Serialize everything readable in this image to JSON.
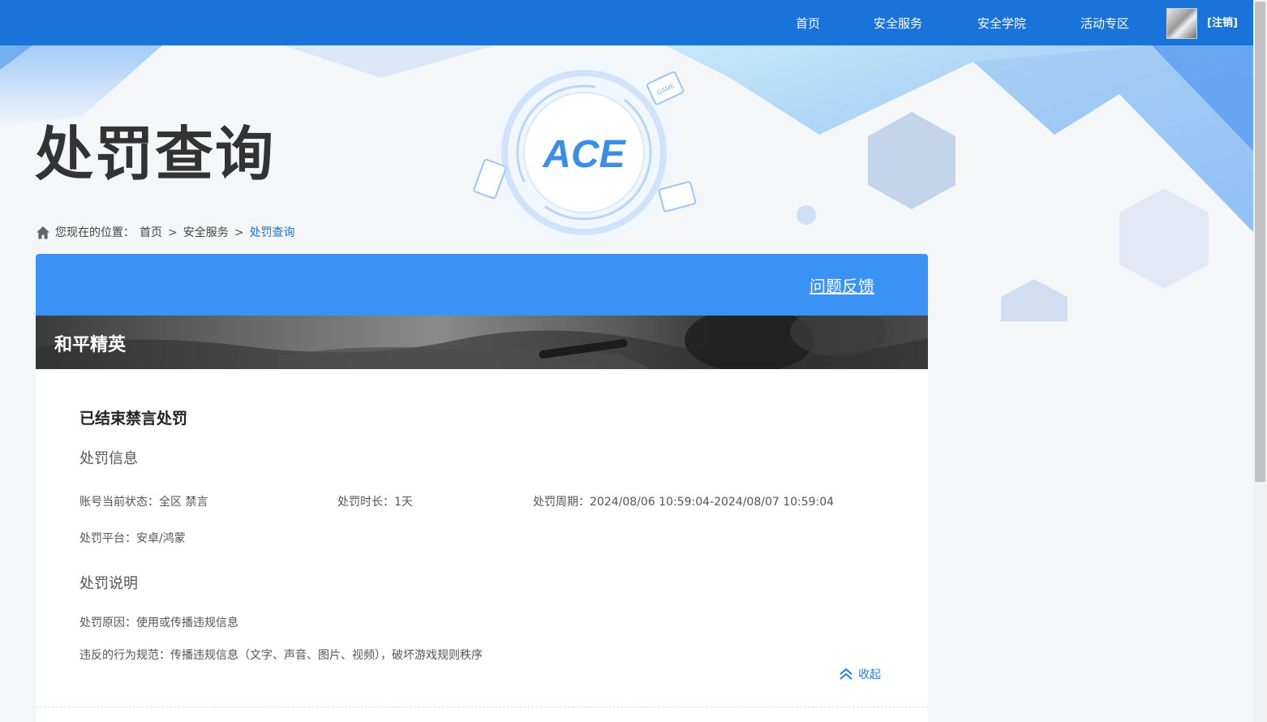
{
  "nav": {
    "items": [
      "首页",
      "安全服务",
      "安全学院",
      "活动专区"
    ],
    "logout": "[注销]"
  },
  "hero": {
    "title": "处罚查询",
    "logo_text": "ACE",
    "badge_text": "GAME"
  },
  "breadcrumb": {
    "prefix": "您现在的位置：",
    "items": [
      "首页",
      "安全服务",
      "处罚查询"
    ],
    "separator": ">"
  },
  "panel": {
    "feedback_link": "问题反馈",
    "game_name": "和平精英"
  },
  "penalty": {
    "status_title": "已结束禁言处罚",
    "info_title": "处罚信息",
    "account_status": "账号当前状态：全区 禁言",
    "duration": "处罚时长：1天",
    "period": "处罚周期：2024/08/06 10:59:04-2024/08/07 10:59:04",
    "platform": "处罚平台：安卓/鸿蒙",
    "desc_title": "处罚说明",
    "reason": "处罚原因：使用或传播违规信息",
    "rule": "违反的行为规范：传播违规信息（文字、声音、图片、视频），破坏游戏规则秩序",
    "collapse_label": "收起"
  },
  "colors": {
    "nav_bg": "#1a73d9",
    "panel_head": "#3a92f5",
    "link": "#1a73d9"
  },
  "icons": [
    "home-icon",
    "double-chevron-up-icon"
  ]
}
